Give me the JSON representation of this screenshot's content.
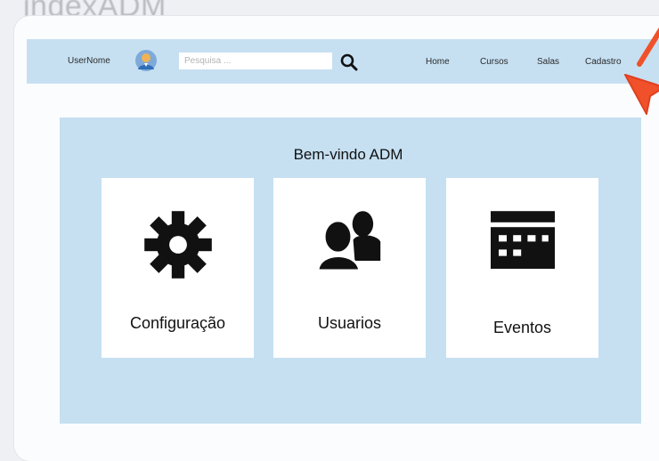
{
  "page": {
    "title": "indexADM"
  },
  "header": {
    "username": "UserNome",
    "search_placeholder": "Pesquisa ...",
    "nav": [
      {
        "label": "Home"
      },
      {
        "label": "Cursos"
      },
      {
        "label": "Salas"
      },
      {
        "label": "Cadastro"
      }
    ]
  },
  "main": {
    "welcome": "Bem-vindo ADM",
    "cards": [
      {
        "label": "Configuração",
        "icon": "gear-icon"
      },
      {
        "label": "Usuarios",
        "icon": "users-icon"
      },
      {
        "label": "Eventos",
        "icon": "calendar-icon"
      }
    ]
  },
  "colors": {
    "navbar": "#c6e0f2",
    "panel": "#c6e0f2",
    "card": "#ffffff",
    "cursor": "#f0512a"
  }
}
